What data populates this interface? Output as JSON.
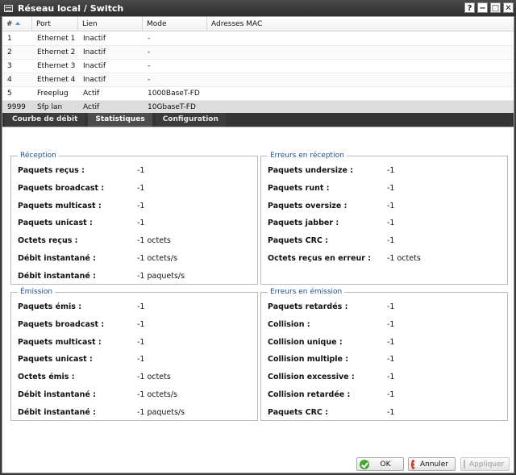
{
  "window": {
    "title": "Réseau local / Switch",
    "controls": [
      "?",
      "−",
      "□",
      "✕"
    ]
  },
  "table": {
    "columns": [
      "#",
      "Port",
      "Lien",
      "Mode",
      "Adresses MAC"
    ],
    "rows": [
      {
        "num": "1",
        "port": "Ethernet 1",
        "link": "Inactif",
        "mode": "-",
        "mac": ""
      },
      {
        "num": "2",
        "port": "Ethernet 2",
        "link": "Inactif",
        "mode": "-",
        "mac": ""
      },
      {
        "num": "3",
        "port": "Ethernet 3",
        "link": "Inactif",
        "mode": "-",
        "mac": ""
      },
      {
        "num": "4",
        "port": "Ethernet 4",
        "link": "Inactif",
        "mode": "-",
        "mac": ""
      },
      {
        "num": "5",
        "port": "Freeplug",
        "link": "Actif",
        "mode": "1000BaseT-FD",
        "mac": ""
      },
      {
        "num": "9999",
        "port": "Sfp lan",
        "link": "Actif",
        "mode": "10GbaseT-FD",
        "mac": ""
      }
    ]
  },
  "tabs": [
    "Courbe de débit",
    "Statistiques",
    "Configuration"
  ],
  "active_tab": "Statistiques",
  "groups": {
    "rx": {
      "title": "Réception",
      "items": [
        {
          "label": "Paquets reçus :",
          "value": "-1"
        },
        {
          "label": "Paquets broadcast :",
          "value": "-1"
        },
        {
          "label": "Paquets multicast :",
          "value": "-1"
        },
        {
          "label": "Paquets unicast :",
          "value": "-1"
        },
        {
          "label": "Octets reçus :",
          "value": "-1 octets"
        },
        {
          "label": "Débit instantané :",
          "value": "-1 octets/s"
        },
        {
          "label": "Débit instantané :",
          "value": "-1 paquets/s"
        }
      ]
    },
    "rx_err": {
      "title": "Erreurs en réception",
      "items": [
        {
          "label": "Paquets undersize :",
          "value": "-1"
        },
        {
          "label": "Paquets runt :",
          "value": "-1"
        },
        {
          "label": "Paquets oversize :",
          "value": "-1"
        },
        {
          "label": "Paquets jabber :",
          "value": "-1"
        },
        {
          "label": "Paquets CRC :",
          "value": "-1"
        },
        {
          "label": "Octets reçus en erreur :",
          "value": "-1 octets"
        }
      ]
    },
    "tx": {
      "title": "Émission",
      "items": [
        {
          "label": "Paquets émis :",
          "value": "-1"
        },
        {
          "label": "Paquets broadcast :",
          "value": "-1"
        },
        {
          "label": "Paquets multicast :",
          "value": "-1"
        },
        {
          "label": "Paquets unicast :",
          "value": "-1"
        },
        {
          "label": "Octets émis :",
          "value": "-1 octets"
        },
        {
          "label": "Débit instantané :",
          "value": "-1 octets/s"
        },
        {
          "label": "Débit instantané :",
          "value": "-1 paquets/s"
        }
      ]
    },
    "tx_err": {
      "title": "Erreurs en émission",
      "items": [
        {
          "label": "Paquets retardés :",
          "value": "-1"
        },
        {
          "label": "Collision :",
          "value": "-1"
        },
        {
          "label": "Collision unique :",
          "value": "-1"
        },
        {
          "label": "Collision multiple :",
          "value": "-1"
        },
        {
          "label": "Collision excessive :",
          "value": "-1"
        },
        {
          "label": "Collision retardée :",
          "value": "-1"
        },
        {
          "label": "Paquets CRC :",
          "value": "-1"
        }
      ]
    }
  },
  "buttons": {
    "ok": "OK",
    "cancel": "Annuler",
    "apply": "Appliquer"
  }
}
